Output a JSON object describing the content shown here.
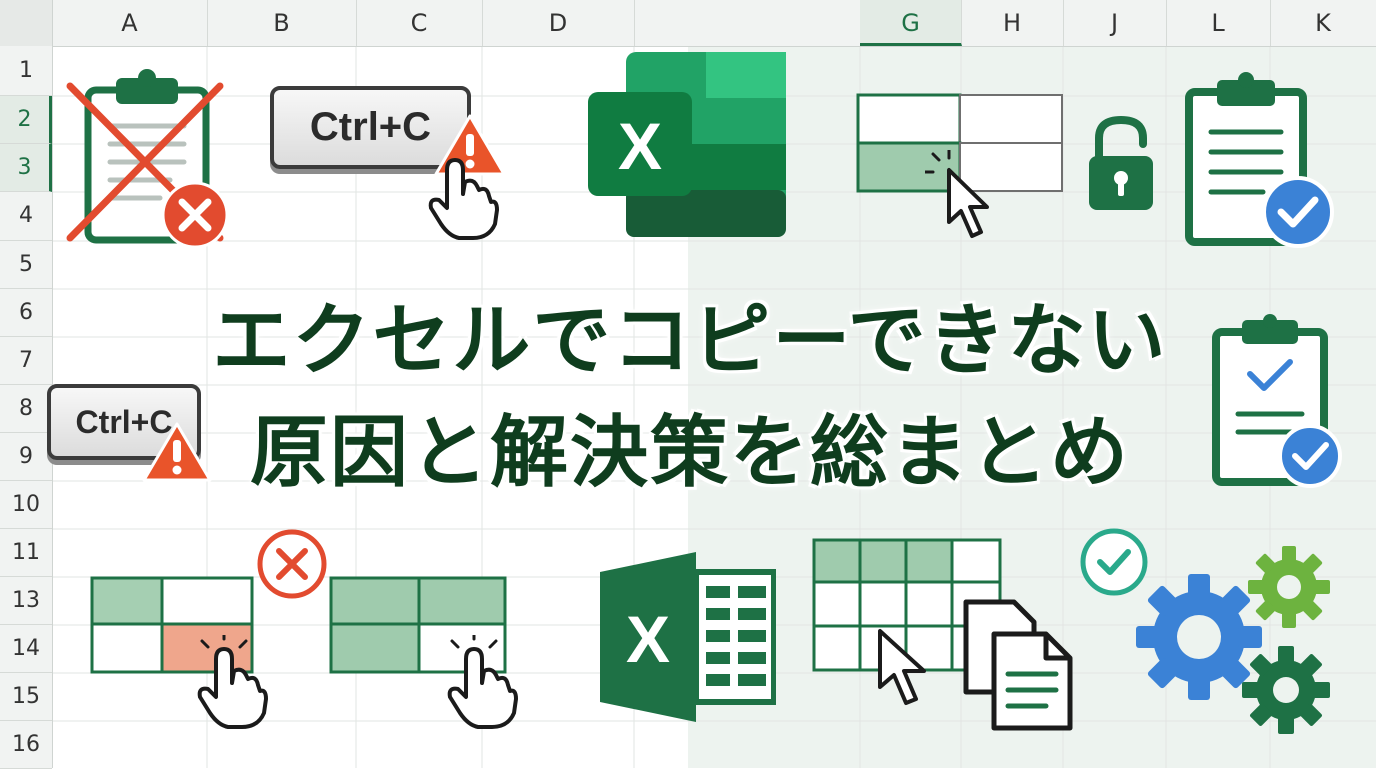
{
  "spreadsheet": {
    "column_headers": [
      "A",
      "B",
      "C",
      "D",
      "G",
      "H",
      "J",
      "L",
      "K"
    ],
    "selected_column": "G",
    "row_headers": [
      "1",
      "2",
      "3",
      "4",
      "5",
      "6",
      "7",
      "8",
      "9",
      "10",
      "11",
      "13",
      "14",
      "15",
      "16"
    ],
    "selected_rows": [
      "2",
      "3"
    ]
  },
  "title": {
    "line1": "エクセルでコピーできない",
    "line2": "原因と解決策を総まとめ"
  },
  "keys": {
    "top": "Ctrl+C",
    "left": "Ctrl+C"
  },
  "icons": {
    "excel_logo_letter": "X",
    "names": [
      "clipboard-crossed-icon",
      "error-icon",
      "warning-icon",
      "pointer-hand-icon",
      "excel-logo-icon",
      "lock-open-icon",
      "clipboard-check-icon",
      "check-badge-icon",
      "cursor-arrow-icon",
      "copy-documents-icon",
      "gear-icon"
    ]
  },
  "colors": {
    "excel_green": "#1e7145",
    "dark_green": "#0f3d1e",
    "error_red": "#e24b2f",
    "warning_orange": "#e9542a",
    "check_blue": "#3b82d6",
    "right_background": "#edf3ef"
  }
}
